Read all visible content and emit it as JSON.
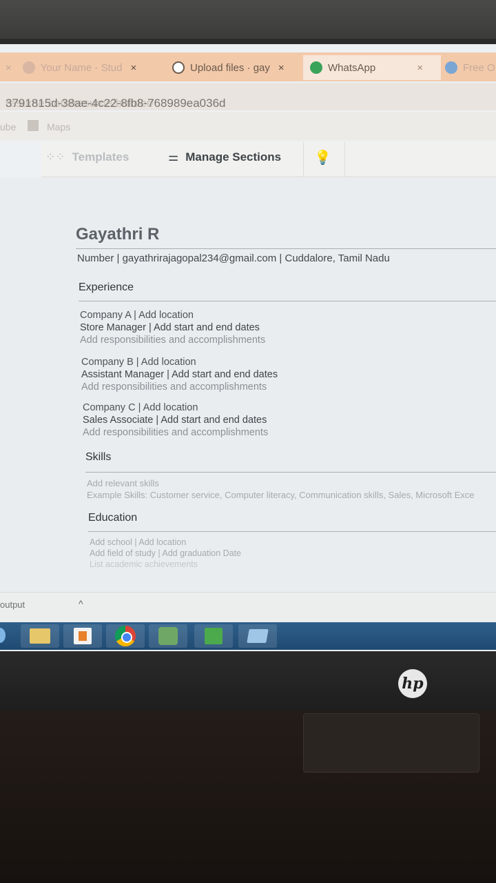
{
  "browser": {
    "tabs": [
      {
        "label": "Your Name - Stud",
        "close": "×",
        "icon": "globe-icon"
      },
      {
        "label": "Upload files · gay",
        "close": "×",
        "icon": "github-icon"
      },
      {
        "label": "WhatsApp",
        "close": "×",
        "icon": "whatsapp-icon"
      },
      {
        "label": "Free O",
        "icon": "globe-icon"
      }
    ],
    "address_faded": "resume.com/resume/builder/",
    "address": "3791815d-38ae-4c22-8fb8-768989ea036d",
    "bookmarks": [
      {
        "label": "ube"
      },
      {
        "label": "Maps",
        "icon": "maps-icon"
      }
    ]
  },
  "app_toolbar": {
    "templates": {
      "label": "Templates",
      "icon": "grid-icon"
    },
    "manage_sections": {
      "label": "Manage Sections",
      "icon": "sliders-icon"
    },
    "tips": {
      "icon": "lightbulb-icon"
    }
  },
  "resume": {
    "name": "Gayathri R",
    "contact": "Number | gayathrirajagopal234@gmail.com | Cuddalore, Tamil Nadu",
    "experience_heading": "Experience",
    "experience": [
      {
        "company": "Company A | Add location",
        "role": "Store Manager | Add start and end dates",
        "details": "Add responsibilities and accomplishments"
      },
      {
        "company": "Company B | Add location",
        "role": "Assistant Manager | Add start and end dates",
        "details": "Add responsibilities and accomplishments"
      },
      {
        "company": "Company C | Add location",
        "role": "Sales Associate | Add start and end dates",
        "details": "Add responsibilities and accomplishments"
      }
    ],
    "skills_heading": "Skills",
    "skills": [
      "Add relevant skills",
      "Example Skills: Customer service, Computer literacy, Communication skills, Sales, Microsoft Exce"
    ],
    "education_heading": "Education",
    "education": [
      "Add school | Add location",
      "Add field of study | Add graduation Date",
      "List academic achievements"
    ]
  },
  "status": {
    "output": "output",
    "chevron": "^"
  },
  "taskbar": [
    "folder-icon",
    "media-player-icon",
    "chrome-icon",
    "android-studio-icon",
    "docs-icon",
    "network-icon"
  ],
  "brand": "hp"
}
